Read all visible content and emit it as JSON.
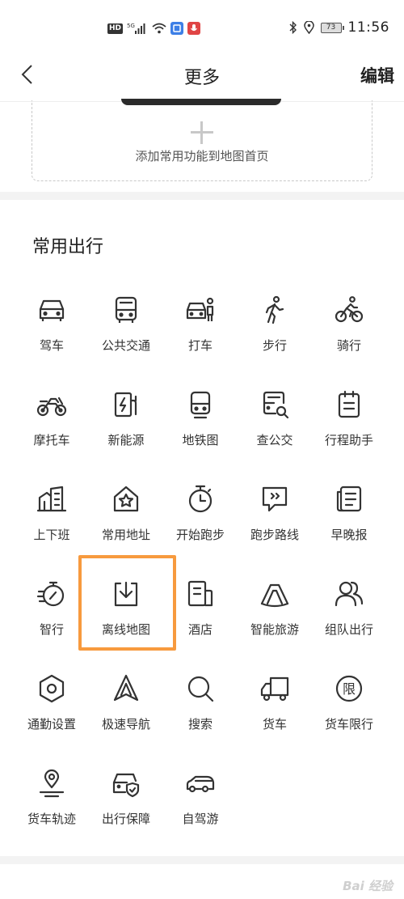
{
  "status_bar": {
    "network_badge": "HD",
    "signal_label": "5G",
    "battery": "73",
    "time": "11:56"
  },
  "header": {
    "title": "更多",
    "edit_label": "编辑"
  },
  "add_card": {
    "label": "添加常用功能到地图首页"
  },
  "section": {
    "title": "常用出行"
  },
  "items": [
    {
      "label": "驾车",
      "icon": "car-icon"
    },
    {
      "label": "公共交通",
      "icon": "bus-icon"
    },
    {
      "label": "打车",
      "icon": "taxi-icon"
    },
    {
      "label": "步行",
      "icon": "walk-icon"
    },
    {
      "label": "骑行",
      "icon": "bike-icon"
    },
    {
      "label": "摩托车",
      "icon": "motorcycle-icon"
    },
    {
      "label": "新能源",
      "icon": "charging-icon"
    },
    {
      "label": "地铁图",
      "icon": "subway-icon"
    },
    {
      "label": "查公交",
      "icon": "bus-search-icon"
    },
    {
      "label": "行程助手",
      "icon": "itinerary-icon"
    },
    {
      "label": "上下班",
      "icon": "commute-icon"
    },
    {
      "label": "常用地址",
      "icon": "home-star-icon"
    },
    {
      "label": "开始跑步",
      "icon": "stopwatch-icon"
    },
    {
      "label": "跑步路线",
      "icon": "run-route-icon"
    },
    {
      "label": "早晚报",
      "icon": "news-icon"
    },
    {
      "label": "智行",
      "icon": "smart-travel-icon"
    },
    {
      "label": "离线地图",
      "icon": "download-icon"
    },
    {
      "label": "酒店",
      "icon": "hotel-icon"
    },
    {
      "label": "智能旅游",
      "icon": "tour-icon"
    },
    {
      "label": "组队出行",
      "icon": "group-icon"
    },
    {
      "label": "通勤设置",
      "icon": "settings-hex-icon"
    },
    {
      "label": "极速导航",
      "icon": "navigation-icon"
    },
    {
      "label": "搜索",
      "icon": "search-icon"
    },
    {
      "label": "货车",
      "icon": "truck-icon"
    },
    {
      "label": "货车限行",
      "icon": "restriction-icon"
    },
    {
      "label": "货车轨迹",
      "icon": "location-track-icon"
    },
    {
      "label": "出行保障",
      "icon": "car-shield-icon"
    },
    {
      "label": "自驾游",
      "icon": "self-drive-icon"
    }
  ],
  "highlight_color": "#f79a3e",
  "watermark": "Bai 经验"
}
